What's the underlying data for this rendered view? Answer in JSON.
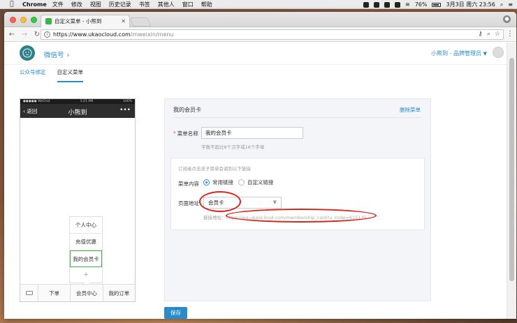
{
  "menubar": {
    "apple": "",
    "app": "Chrome",
    "items": [
      "文件",
      "修改",
      "视图",
      "历史记录",
      "书签",
      "其他人",
      "窗口",
      "帮助"
    ],
    "battery": "76%",
    "clock": "3月3日 周六 23:56"
  },
  "browser": {
    "tab_title": "自定义菜单 - 小熊到",
    "url_host": "https://www.ukaocloud.com",
    "url_path": "/mweixin/menu"
  },
  "header": {
    "site_title": "微信号",
    "user": "小熊到 - 品牌管理员"
  },
  "subnav": {
    "items": [
      "公众号绑定",
      "自定义菜单"
    ],
    "active": "自定义菜单"
  },
  "phone": {
    "carrier": "●●●●● WeChat",
    "time": "1:21 AM",
    "battery": "100%",
    "back_label": "返回",
    "title": "小熊到",
    "more": "•••",
    "submenu": [
      "个人中心",
      "充值优惠",
      "我的会员卡"
    ],
    "add": "+",
    "menu": [
      "下单",
      "会员中心",
      "我的订单"
    ]
  },
  "editor": {
    "title": "我的会员卡",
    "delete_label": "删除菜单",
    "name_label": "菜单名称",
    "name_value": "我的会员卡",
    "name_hint": "字数不超过8个汉字或16个字母",
    "content_hint": "订阅者点击该子菜单会调到以下链接",
    "content_label": "菜单内容",
    "radio_common": "常用链接",
    "radio_custom": "自定义链接",
    "page_label": "页面地址",
    "page_value": "会员卡",
    "link_label": "链接地址",
    "link_url": "https://wx.ukaocloud.com/membership_card?u_code=615135"
  },
  "save_label": "保存",
  "colors": {
    "accent": "#2a8bc9",
    "annotation": "#d9241c",
    "selected": "#44b549"
  }
}
